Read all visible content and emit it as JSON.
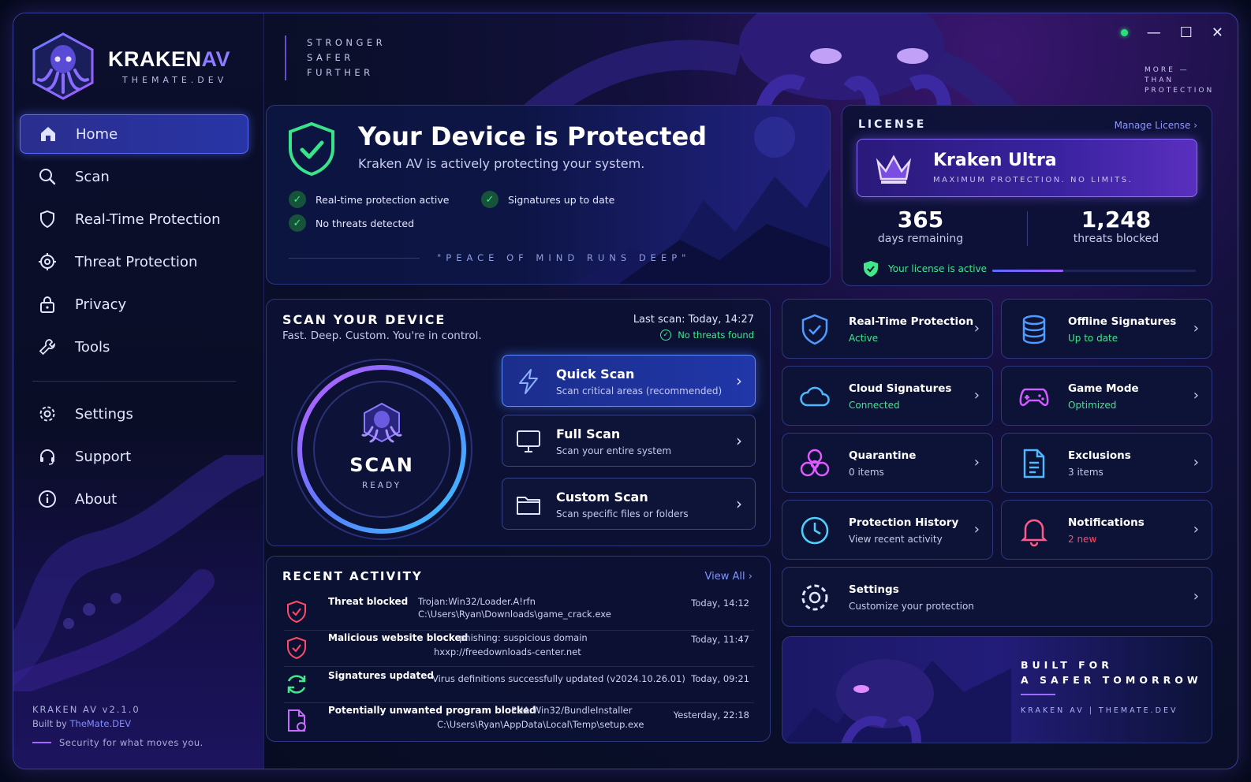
{
  "brand": {
    "name": "KRAKEN",
    "name_accent": "AV",
    "sub": "THEMATE.DEV"
  },
  "slogan": [
    "STRONGER",
    "SAFER",
    "FURTHER"
  ],
  "corner_text": [
    "MORE —",
    "THAN",
    "PROTECTION"
  ],
  "window_controls": {
    "minimize": "—",
    "maximize": "☐",
    "close": "✕",
    "status_color": "#27e27a"
  },
  "nav": {
    "items": [
      {
        "label": "Home",
        "icon": "home-icon",
        "active": true
      },
      {
        "label": "Scan",
        "icon": "search-icon"
      },
      {
        "label": "Real-Time Protection",
        "icon": "shield-icon"
      },
      {
        "label": "Threat Protection",
        "icon": "crosshair-icon"
      },
      {
        "label": "Privacy",
        "icon": "lock-icon"
      },
      {
        "label": "Tools",
        "icon": "wrench-icon"
      }
    ],
    "secondary": [
      {
        "label": "Settings",
        "icon": "gear-icon"
      },
      {
        "label": "Support",
        "icon": "headset-icon"
      },
      {
        "label": "About",
        "icon": "info-icon"
      }
    ]
  },
  "sidebar_footer": {
    "version": "KRAKEN AV v2.1.0",
    "built_by": "Built by",
    "built_link": "TheMate.DEV",
    "tagline": "Security for what moves you."
  },
  "hero": {
    "title": "Your Device is Protected",
    "subtitle": "Kraken AV is actively protecting your system.",
    "checks": [
      "Real-time protection active",
      "Signatures up to date",
      "No threats detected"
    ],
    "motto": "\"PEACE OF MIND RUNS DEEP\""
  },
  "license": {
    "heading": "LICENSE",
    "manage": "Manage License",
    "plan": "Kraken Ultra",
    "tier": "MAXIMUM PROTECTION. NO LIMITS.",
    "days": "365",
    "days_label": "days remaining",
    "threats": "1,248",
    "threats_label": "threats blocked",
    "status": "Your license is active",
    "progress": 0.35
  },
  "scan": {
    "title": "SCAN YOUR DEVICE",
    "subtitle": "Fast. Deep. Custom. You're in control.",
    "last_scan": "Last scan: Today, 14:27",
    "result": "No threats found",
    "ring_label": "SCAN",
    "ring_status": "READY",
    "options": [
      {
        "title": "Quick Scan",
        "desc": "Scan critical areas (recommended)"
      },
      {
        "title": "Full Scan",
        "desc": "Scan your entire system"
      },
      {
        "title": "Custom Scan",
        "desc": "Scan specific files or folders"
      }
    ]
  },
  "recent": {
    "title": "RECENT ACTIVITY",
    "view_all": "View All",
    "rows": [
      {
        "kind": "Threat blocked",
        "line1": "Trojan:Win32/Loader.A!rfn",
        "line2": "C:\\Users\\Ryan\\Downloads\\game_crack.exe",
        "time": "Today, 14:12"
      },
      {
        "kind": "Malicious website blocked",
        "line1": "phishing: suspicious domain",
        "line2": "hxxp://freedownloads-center.net",
        "time": "Today, 11:47"
      },
      {
        "kind": "Signatures updated",
        "line1": "Virus definitions successfully updated (v2024.10.26.01)",
        "line2": "",
        "time": "Today, 09:21"
      },
      {
        "kind": "Potentially unwanted program blocked",
        "line1": "PUA:Win32/BundleInstaller",
        "line2": "C:\\Users\\Ryan\\AppData\\Local\\Temp\\setup.exe",
        "time": "Yesterday, 22:18"
      }
    ]
  },
  "tiles": [
    {
      "title": "Real-Time Protection",
      "status": "Active",
      "icon": "shield-check-icon"
    },
    {
      "title": "Offline Signatures",
      "status": "Up to date",
      "icon": "database-icon"
    },
    {
      "title": "Cloud Signatures",
      "status": "Connected",
      "icon": "cloud-icon"
    },
    {
      "title": "Game Mode",
      "status": "Optimized",
      "icon": "gamepad-icon"
    },
    {
      "title": "Quarantine",
      "status": "0 items",
      "icon": "biohazard-icon"
    },
    {
      "title": "Exclusions",
      "status": "3 items",
      "icon": "document-icon"
    },
    {
      "title": "Protection History",
      "status": "View recent activity",
      "icon": "clock-icon"
    },
    {
      "title": "Notifications",
      "status": "2 new",
      "icon": "bell-icon"
    },
    {
      "title": "Settings",
      "status": "Customize your protection",
      "icon": "gear-icon"
    }
  ],
  "banner": {
    "line1": "BUILT FOR",
    "line2": "A SAFER TOMORROW",
    "sub": "KRAKEN AV  |  THEMATE.DEV"
  },
  "colors": {
    "accent": "#5b6bff",
    "success": "#40e88b",
    "alert": "#ff4a6a",
    "purple": "#9d6bff"
  }
}
